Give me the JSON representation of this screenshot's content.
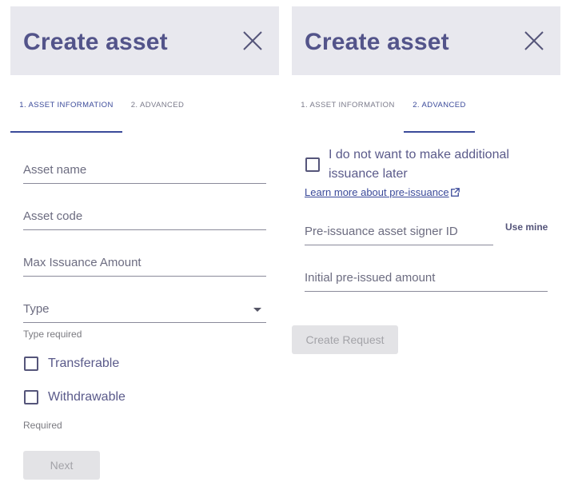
{
  "left_panel": {
    "title": "Create asset",
    "tabs": [
      {
        "label": "1. Asset Information",
        "active": true
      },
      {
        "label": "2. Advanced",
        "active": false
      }
    ],
    "fields": {
      "asset_name": {
        "placeholder": "Asset name",
        "value": ""
      },
      "asset_code": {
        "placeholder": "Asset code",
        "value": ""
      },
      "max_issuance": {
        "placeholder": "Max Issuance Amount",
        "value": ""
      },
      "type": {
        "placeholder": "Type",
        "value": ""
      }
    },
    "type_hint": "Type required",
    "checkboxes": [
      {
        "label": "Transferable",
        "checked": false
      },
      {
        "label": "Withdrawable",
        "checked": false
      }
    ],
    "checkbox_hint": "Required",
    "next_label": "Next"
  },
  "right_panel": {
    "title": "Create asset",
    "tabs": [
      {
        "label": "1. Asset Information",
        "active": false
      },
      {
        "label": "2. Advanced",
        "active": true
      }
    ],
    "preissuance_checkbox": {
      "label_line1": "I do not want to make additional",
      "label_line2": "issuance later",
      "checked": false
    },
    "learn_more_link": "Learn more about pre-issuance",
    "fields": {
      "signer_id": {
        "placeholder": "Pre-issuance asset signer ID",
        "value": ""
      },
      "initial_amount": {
        "placeholder": "Initial pre-issued amount",
        "value": ""
      }
    },
    "use_mine_label": "Use mine",
    "create_request_label": "Create Request"
  },
  "colors": {
    "title": "#53548a",
    "header_bg": "#e8e8ee",
    "accent": "#3b4a9a",
    "disabled_button_bg": "#e3e3e6",
    "disabled_button_text": "#a3a3a8"
  }
}
